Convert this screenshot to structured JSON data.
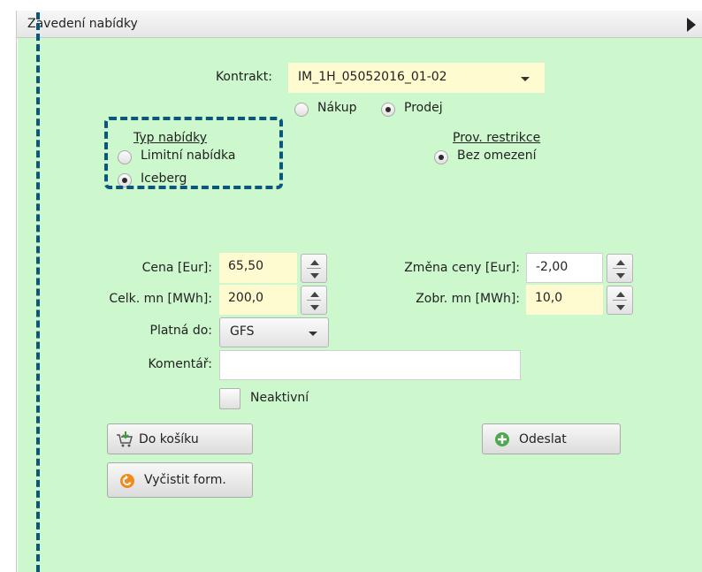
{
  "header": {
    "title": "Zavedení nabídky"
  },
  "contract": {
    "label": "Kontrakt:",
    "value": "IM_1H_05052016_01-02"
  },
  "side": {
    "buy_label": "Nákup",
    "sell_label": "Prodej",
    "selected": "Prodej"
  },
  "offer_type": {
    "title": "Typ nabídky",
    "options": [
      "Limitní nabídka",
      "Iceberg"
    ],
    "selected": "Iceberg"
  },
  "restriction": {
    "title": "Prov. restrikce",
    "options": [
      "Bez omezení"
    ],
    "selected": "Bez omezení"
  },
  "fields": {
    "price": {
      "label": "Cena [Eur]:",
      "value": "65,50"
    },
    "price_change": {
      "label": "Změna ceny [Eur]:",
      "value": "-2,00"
    },
    "total_qty": {
      "label": "Celk. mn [MWh]:",
      "value": "200,0"
    },
    "display_qty": {
      "label": "Zobr. mn [MWh]:",
      "value": "10,0"
    },
    "valid_until": {
      "label": "Platná do:",
      "value": "GFS"
    },
    "comment": {
      "label": "Komentář:",
      "value": ""
    },
    "inactive": {
      "label": "Neaktivní",
      "checked": false
    }
  },
  "buttons": {
    "to_cart": "Do košíku",
    "send": "Odeslat",
    "clear": "Vyčistit form."
  },
  "colors": {
    "panel_background": "#cdf7cd",
    "input_background": "#fffbd0",
    "annotation_dash": "#0b567a",
    "send_icon": "#4fa84f",
    "clear_icon": "#f08a1c"
  }
}
